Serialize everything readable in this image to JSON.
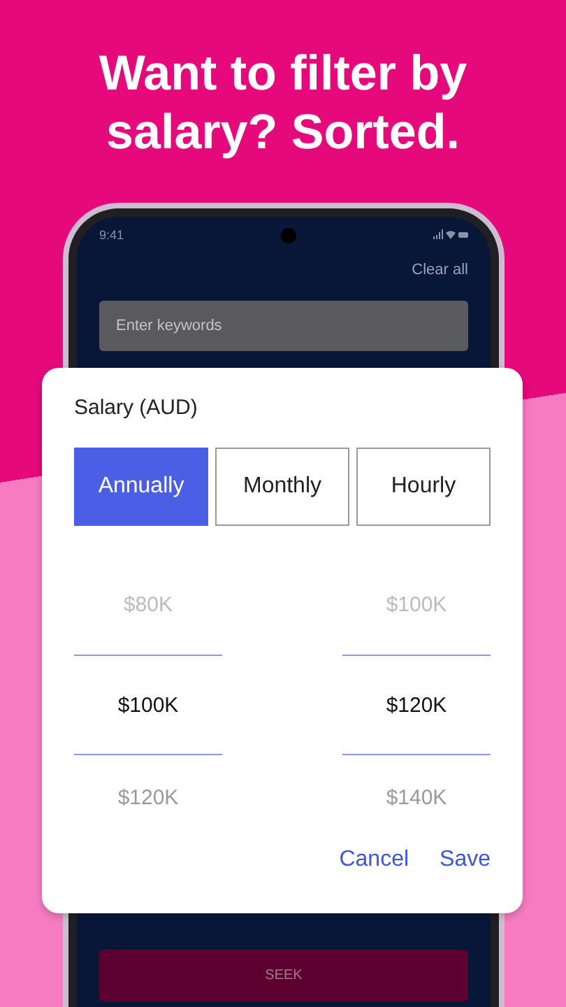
{
  "headline": {
    "lines": [
      "Want to filter by",
      "salary? Sorted."
    ]
  },
  "status_bar": {
    "time": "9:41"
  },
  "screen": {
    "clear_all": "Clear all",
    "keywords_field": {
      "placeholder": "Enter keywords"
    },
    "seek_button": "SEEK"
  },
  "dialog": {
    "title": "Salary (AUD)",
    "periods": [
      {
        "label": "Annually",
        "selected": true
      },
      {
        "label": "Monthly",
        "selected": false
      },
      {
        "label": "Hourly",
        "selected": false
      }
    ],
    "pickers": [
      {
        "values": [
          {
            "label": "$80K",
            "selected": false
          },
          {
            "label": "$100K",
            "selected": true
          },
          {
            "label": "$120K",
            "selected": false
          }
        ]
      },
      {
        "values": [
          {
            "label": "$100K",
            "selected": false
          },
          {
            "label": "$120K",
            "selected": true
          },
          {
            "label": "$140K",
            "selected": false
          }
        ]
      }
    ],
    "actions": [
      {
        "label": "Cancel"
      },
      {
        "label": "Save"
      }
    ]
  }
}
